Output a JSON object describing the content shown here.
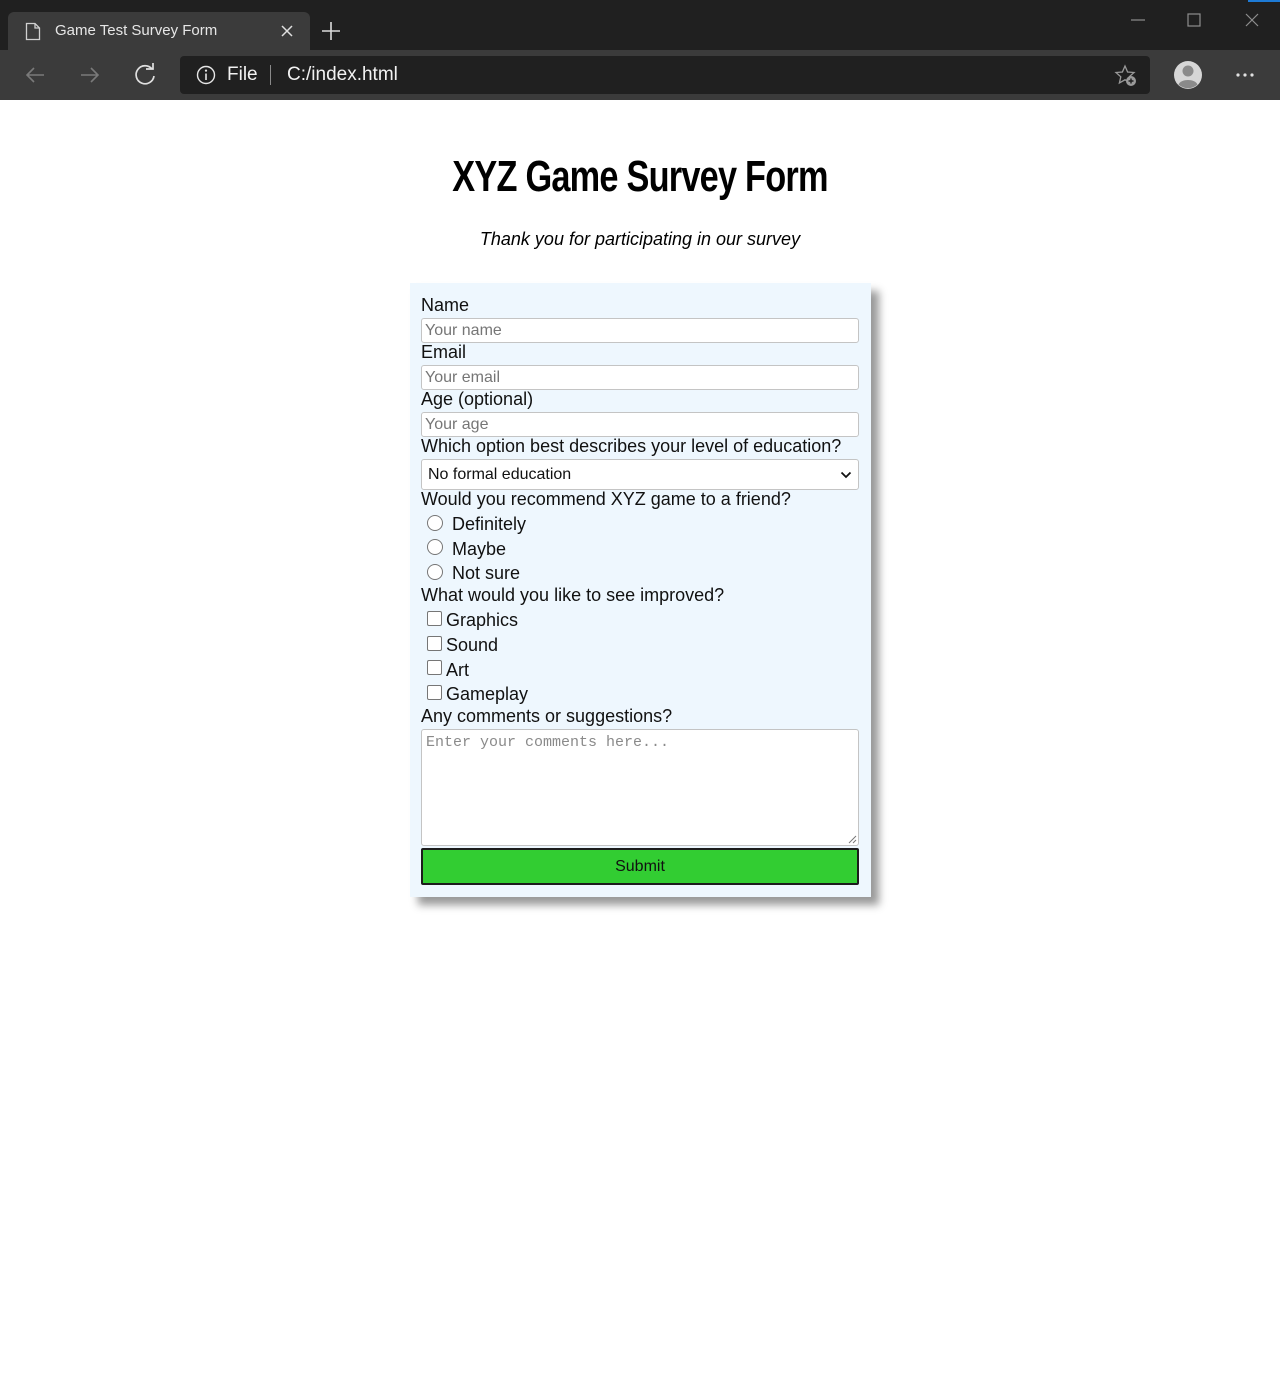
{
  "browser": {
    "tab_title": "Game Test Survey Form",
    "address_scheme": "File",
    "address_url": "C:/index.html"
  },
  "page": {
    "title": "XYZ Game Survey Form",
    "description": "Thank you for participating in our survey"
  },
  "form": {
    "name": {
      "label": "Name",
      "placeholder": "Your name"
    },
    "email": {
      "label": "Email",
      "placeholder": "Your email"
    },
    "age": {
      "label": "Age (optional)",
      "placeholder": "Your age"
    },
    "education": {
      "label": "Which option best describes your level of education?",
      "selected": "No formal education"
    },
    "recommend": {
      "label": "Would you recommend XYZ game to a friend?",
      "options": [
        "Definitely",
        "Maybe",
        "Not sure"
      ]
    },
    "improve": {
      "label": "What would you like to see improved?",
      "options": [
        "Graphics",
        "Sound",
        "Art",
        "Gameplay"
      ]
    },
    "comments": {
      "label": "Any comments or suggestions?",
      "placeholder": "Enter your comments here..."
    },
    "submit_label": "Submit"
  },
  "colors": {
    "chrome_dark": "#202020",
    "chrome_mid": "#3b3b3b",
    "form_background": "#eef7fe",
    "submit_green": "#32cd32"
  },
  "icons": [
    "page-icon",
    "close-icon",
    "plus-icon",
    "minimize-icon",
    "maximize-icon",
    "back-arrow-icon",
    "forward-arrow-icon",
    "reload-icon",
    "info-icon",
    "favorite-star-icon",
    "profile-icon",
    "more-icon",
    "chevron-down-icon",
    "resize-grip-icon"
  ]
}
